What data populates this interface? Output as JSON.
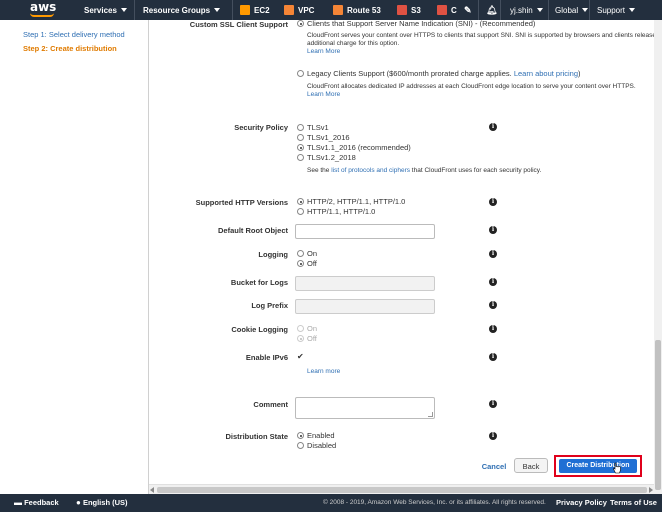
{
  "nav": {
    "services": "Services",
    "resource_groups": "Resource Groups",
    "ec2": "EC2",
    "vpc": "VPC",
    "route53": "Route 53",
    "s3": "S3",
    "c": "C",
    "user": "yj.shin",
    "region": "Global",
    "support": "Support",
    "colors": {
      "bar": "#232f3e",
      "ec2": "#ff9900",
      "vpc": "#f58536",
      "route53": "#f58536",
      "s3": "#e05243"
    }
  },
  "sidebar": {
    "step1": "Step 1: Select delivery method",
    "step2": "Step 2: Create distribution"
  },
  "form": {
    "ssl": {
      "label": "Custom SSL Client Support",
      "sni_option": "Clients that Support Server Name Indication (SNI) - (Recommended)",
      "sni_desc_1": "CloudFront serves your content over HTTPS to clients that support SNI. SNI is supported by browsers and clients released",
      "sni_desc_2": "additional charge for this option.",
      "learn_more_1": "Learn More",
      "legacy_option": "Legacy Clients Support ($600/month prorated charge applies.",
      "legacy_pricing_link": "Learn about pricing",
      "legacy_option_end": ")",
      "legacy_desc": "CloudFront allocates dedicated IP addresses at each CloudFront edge location to serve your content over HTTPS.",
      "learn_more_2": "Learn More"
    },
    "security_policy": {
      "label": "Security Policy",
      "options": [
        "TLSv1",
        "TLSv1_2016",
        "TLSv1.1_2016 (recommended)",
        "TLSv1.2_2018"
      ],
      "selected": 2,
      "note_prefix": "See the ",
      "note_link": "list of protocols and ciphers",
      "note_suffix": " that CloudFront uses for each security policy."
    },
    "http_versions": {
      "label": "Supported HTTP Versions",
      "options": [
        "HTTP/2, HTTP/1.1, HTTP/1.0",
        "HTTP/1.1, HTTP/1.0"
      ],
      "selected": 0
    },
    "default_root": {
      "label": "Default Root Object",
      "value": ""
    },
    "logging": {
      "label": "Logging",
      "options": [
        "On",
        "Off"
      ],
      "selected": 1
    },
    "bucket": {
      "label": "Bucket for Logs",
      "value": ""
    },
    "log_prefix": {
      "label": "Log Prefix",
      "value": ""
    },
    "cookie_logging": {
      "label": "Cookie Logging",
      "options": [
        "On",
        "Off"
      ],
      "selected": 1
    },
    "ipv6": {
      "label": "Enable IPv6",
      "checked": true,
      "learn_more": "Learn more"
    },
    "comment": {
      "label": "Comment",
      "value": ""
    },
    "state": {
      "label": "Distribution State",
      "options": [
        "Enabled",
        "Disabled"
      ],
      "selected": 0
    }
  },
  "actions": {
    "cancel": "Cancel",
    "back": "Back",
    "create": "Create Distribution"
  },
  "footer": {
    "feedback": "Feedback",
    "language": "English (US)",
    "copyright": "© 2008 - 2019, Amazon Web Services, Inc. or its affiliates. All rights reserved.",
    "privacy": "Privacy Policy",
    "terms": "Terms of Use"
  },
  "logo_text": "aws"
}
